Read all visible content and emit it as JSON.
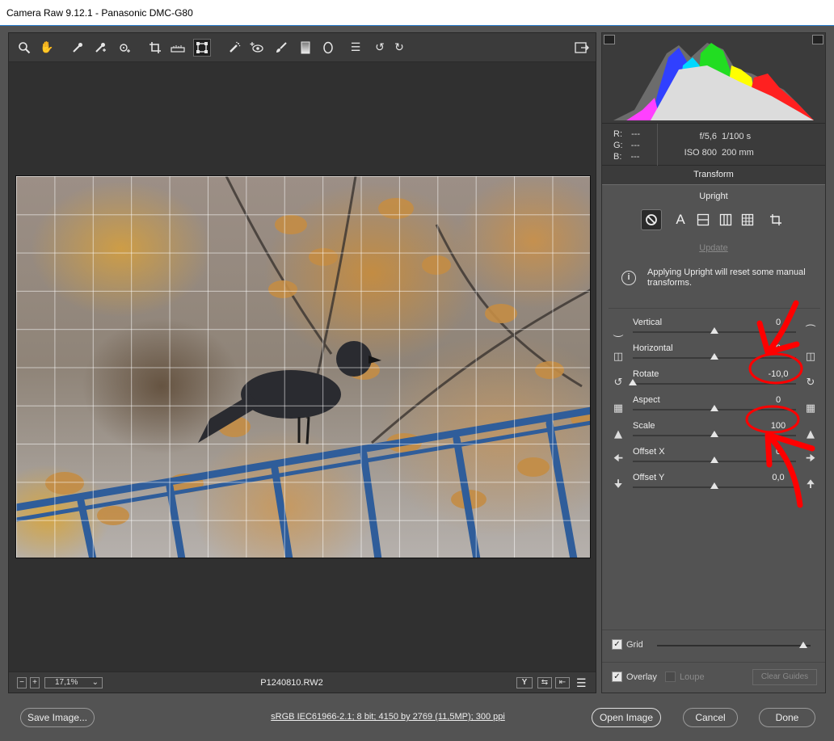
{
  "window": {
    "title": "Camera Raw 9.12.1  -  Panasonic DMC-G80"
  },
  "toolbar": {
    "tools": [
      "zoom-tool",
      "hand-tool",
      "white-balance-tool",
      "color-sampler-tool",
      "targeted-adjustment-tool",
      "crop-tool",
      "straighten-tool",
      "transform-tool",
      "spot-removal-tool",
      "red-eye-tool",
      "adjustment-brush",
      "graduated-filter",
      "radial-filter",
      "preferences",
      "rotate-ccw",
      "rotate-cw"
    ],
    "active_tool": "transform-tool"
  },
  "preview": {
    "filename": "P1240810.RW2",
    "zoom": "17,1%"
  },
  "info": {
    "r_label": "R:",
    "r_value": "---",
    "g_label": "G:",
    "g_value": "---",
    "b_label": "B:",
    "b_value": "---",
    "aperture": "f/5,6",
    "shutter": "1/100 s",
    "iso": "ISO 800",
    "focal": "200 mm"
  },
  "panel": {
    "tab_title": "Transform",
    "upright_label": "Upright",
    "update_label": "Update",
    "notice": "Applying Upright will reset some manual transforms."
  },
  "sliders": [
    {
      "label": "Vertical",
      "value": "0",
      "level": 0.5
    },
    {
      "label": "Horizontal",
      "value": "0",
      "level": 0.5
    },
    {
      "label": "Rotate",
      "value": "-10,0",
      "level": 0.0
    },
    {
      "label": "Aspect",
      "value": "0",
      "level": 0.5
    },
    {
      "label": "Scale",
      "value": "100",
      "level": 0.5
    },
    {
      "label": "Offset X",
      "value": "0",
      "level": 0.5
    },
    {
      "label": "Offset Y",
      "value": "0,0",
      "level": 0.5
    }
  ],
  "options": {
    "grid_label": "Grid",
    "grid_checked": true,
    "grid_level": 0.95,
    "overlay_label": "Overlay",
    "overlay_checked": true,
    "loupe_label": "Loupe",
    "loupe_checked": false,
    "clear_guides_label": "Clear Guides"
  },
  "footer": {
    "save_label": "Save Image...",
    "image_info": "sRGB IEC61966-2.1; 8 bit; 4150 by 2769 (11,5MP); 300 ppi",
    "open_label": "Open Image",
    "cancel_label": "Cancel",
    "done_label": "Done"
  },
  "colors": {
    "panel_bg": "#535353",
    "dark_bg": "#3b3b3b",
    "annotation_red": "#ff0000"
  }
}
